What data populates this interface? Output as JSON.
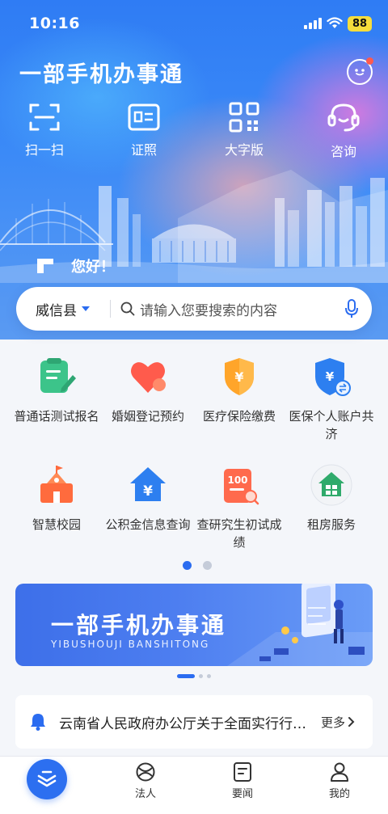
{
  "status_bar": {
    "time": "10:16",
    "battery": "88"
  },
  "header": {
    "brand_title": "一部手机办事通",
    "bot_icon": "chatbot-face-icon"
  },
  "quick_actions": [
    {
      "label": "扫一扫",
      "icon": "scan-icon"
    },
    {
      "label": "证照",
      "icon": "id-card-icon"
    },
    {
      "label": "大字版",
      "icon": "qr-grid-icon"
    },
    {
      "label": "咨询",
      "icon": "headset-icon"
    }
  ],
  "greeting": "您好！",
  "search": {
    "region": "威信县",
    "placeholder": "请输入您要搜索的内容"
  },
  "services": [
    {
      "label": "普通话测试报名",
      "icon": "form-pen-icon",
      "color": "#3cc48a"
    },
    {
      "label": "婚姻登记预约",
      "icon": "heart-icon",
      "color": "#ff5b4c"
    },
    {
      "label": "医疗保险缴费",
      "icon": "yuan-shield-icon",
      "color": "#ff9f1c"
    },
    {
      "label": "医保个人账户共济",
      "icon": "yuan-shield-transfer-icon",
      "color": "#2d7ff0"
    },
    {
      "label": "智慧校园",
      "icon": "school-icon",
      "color": "#ff6b3d"
    },
    {
      "label": "公积金信息查询",
      "icon": "yuan-house-icon",
      "color": "#2d7ff0"
    },
    {
      "label": "查研究生初试成绩",
      "icon": "score-sheet-icon",
      "color": "#ff6a4d"
    },
    {
      "label": "租房服务",
      "icon": "rental-house-icon",
      "color": "#2faa6b"
    }
  ],
  "services_pager": {
    "pages": 2,
    "current": 1,
    "active_color": "#2b6cf0"
  },
  "banner": {
    "title": "一部手机办事通",
    "subtitle": "YIBUSHOUJI BANSHITONG",
    "pages": 3,
    "current": 1
  },
  "notice": {
    "text": "云南省人民政府办公厅关于全面实行行政许可事项清单管理的通知",
    "more_label": "更多"
  },
  "tabbar": {
    "items": [
      {
        "label": "法人",
        "icon": "legal-person-icon"
      },
      {
        "label": "要闻",
        "icon": "news-icon"
      },
      {
        "label": "我的",
        "icon": "user-icon"
      }
    ]
  },
  "colors": {
    "primary": "#2c6ff0",
    "hero_top": "#2f7cf4",
    "hero_pink": "#e878dc"
  }
}
